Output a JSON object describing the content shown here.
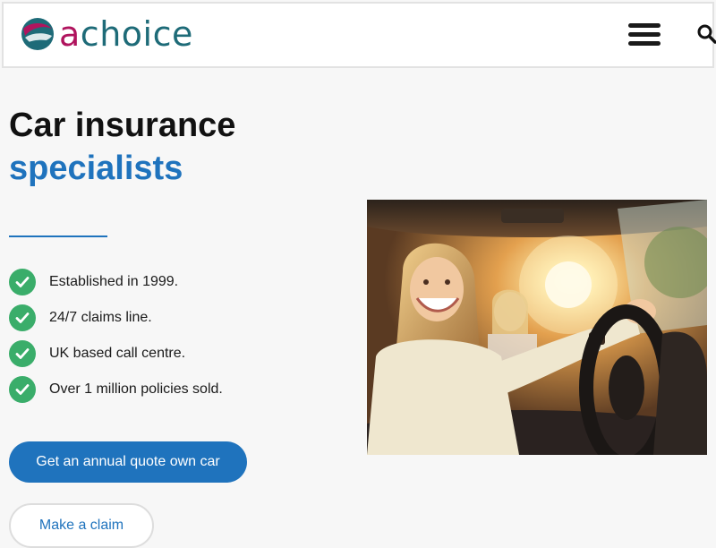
{
  "header": {
    "logo_text_a": "a",
    "logo_text_rest": "choice",
    "menu_icon": "hamburger-menu-icon",
    "search_icon": "search-icon"
  },
  "hero": {
    "title_line1": "Car insurance",
    "title_line2": "specialists",
    "image_description_icon": "photo-woman-driving-car"
  },
  "features": [
    "Established in 1999.",
    "24/7 claims line.",
    "UK based call centre.",
    "Over 1 million policies sold."
  ],
  "buttons": {
    "quote_label": "Get an annual quote own car",
    "claim_label": "Make a claim"
  },
  "colors": {
    "brand_blue": "#1f73bd",
    "brand_teal": "#1e6b78",
    "brand_magenta": "#b0145e",
    "check_green": "#3aad6a"
  }
}
